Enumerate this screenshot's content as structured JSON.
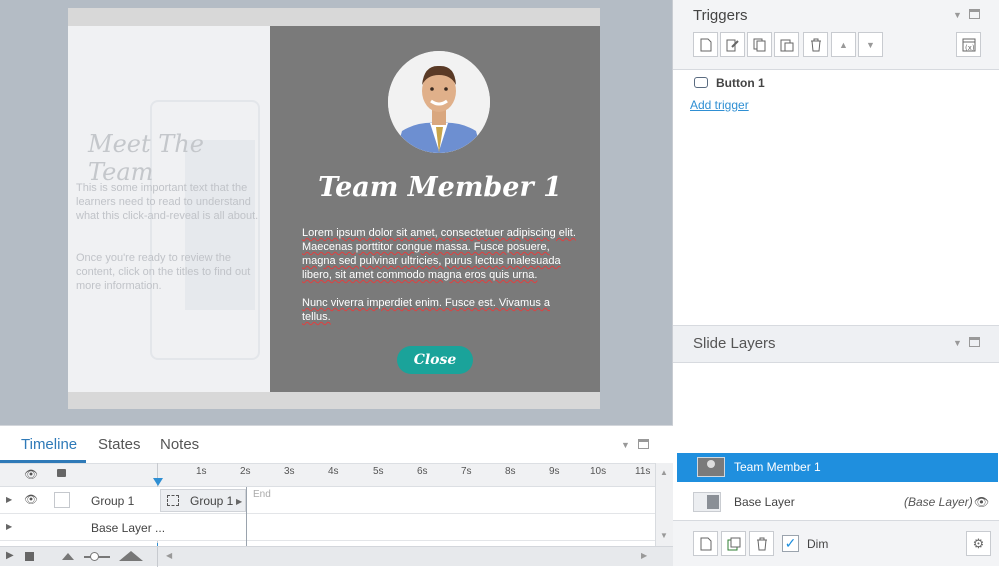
{
  "slide": {
    "left_title": "Meet The Team",
    "left_text1": "This is some important text that the learners need to read to understand what this click-and-reveal is all about.",
    "left_text2": "Once you're ready to review the content, click on the titles to find out more information.",
    "member_name": "Team Member 1",
    "member_p1": "Lorem ipsum dolor sit amet, consectetuer adipiscing elit. Maecenas porttitor congue massa. Fusce posuere, magna sed pulvinar ultricies, purus lectus malesuada libero, sit amet commodo magna eros quis urna.",
    "member_p2": "Nunc viverra imperdiet enim. Fusce est. Vivamus a tellus.",
    "close_label": "Close"
  },
  "triggers": {
    "title": "Triggers",
    "toolbar_icons": [
      "new-trigger-icon",
      "edit-trigger-icon",
      "copy-icon",
      "paste-icon",
      "delete-icon",
      "move-up-icon",
      "move-down-icon"
    ],
    "item_label": "Button 1",
    "add_trigger": "Add trigger"
  },
  "layers": {
    "title": "Slide Layers",
    "rows": [
      {
        "name": "Team Member 1",
        "selected": true
      },
      {
        "name": "Base Layer",
        "note": "(Base Layer)"
      }
    ],
    "dim_label": "Dim",
    "dim_checked": true
  },
  "timeline": {
    "tabs": [
      "Timeline",
      "States",
      "Notes"
    ],
    "active_tab": "Timeline",
    "ticks": [
      "1s",
      "2s",
      "3s",
      "4s",
      "5s",
      "6s",
      "7s",
      "8s",
      "9s",
      "10s",
      "11s"
    ],
    "rows": [
      {
        "name": "Group 1",
        "bar_label": "Group 1",
        "end_label": "End"
      },
      {
        "name": "Base Layer ..."
      }
    ]
  },
  "colors": {
    "accent": "#1f8fde",
    "close_button": "#1aa39a",
    "layer_panel": "#7a7a7a"
  }
}
